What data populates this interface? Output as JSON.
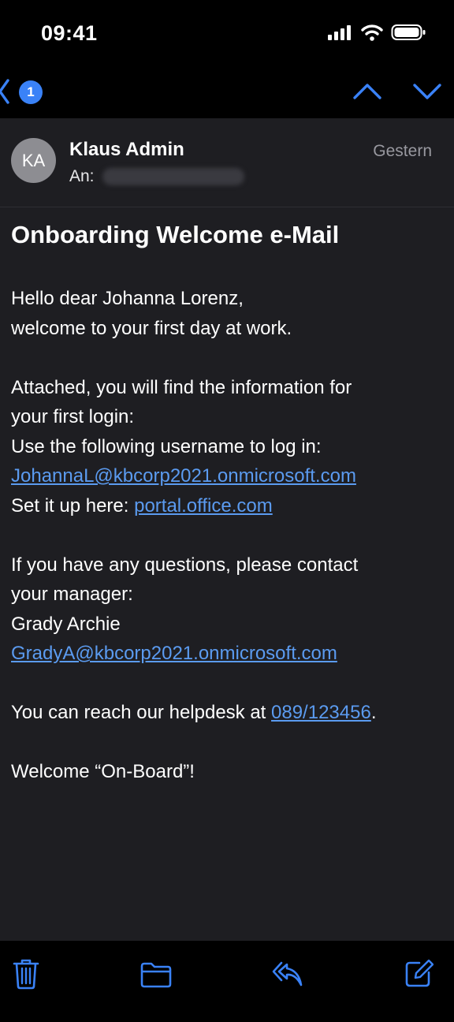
{
  "status_bar": {
    "time": "09:41"
  },
  "nav": {
    "unread_count": "1"
  },
  "message": {
    "avatar_initials": "KA",
    "sender": "Klaus Admin",
    "to_label": "An:",
    "date": "Gestern",
    "subject": "Onboarding Welcome e-Mail",
    "body": {
      "greeting_1": "Hello dear Johanna Lorenz,",
      "greeting_2": "welcome to your first day at work.",
      "attached_1": "Attached, you will find the information for",
      "attached_2": "your first login:",
      "username_intro": "Use the following username to log in:",
      "username_link": "JohannaL@kbcorp2021.onmicrosoft.com",
      "setup_label": "Set it up here: ",
      "setup_link": "portal.office.com",
      "questions_1": "If you have any questions, please contact",
      "questions_2": "your manager:",
      "manager_name": "Grady Archie",
      "manager_link": "GradyA@kbcorp2021.onmicrosoft.com",
      "helpdesk_label": "You can reach our helpdesk at ",
      "helpdesk_link": "089/123456",
      "helpdesk_end": ".",
      "closing": "Welcome “On-Board”!"
    }
  },
  "colors": {
    "accent": "#3a82f7",
    "link": "#5b9bf0",
    "background": "#1e1e22",
    "bars": "#000000"
  },
  "icons": [
    "signal-icon",
    "wifi-icon",
    "battery-icon",
    "back-chevron-icon",
    "previous-message-icon",
    "next-message-icon",
    "trash-icon",
    "folder-icon",
    "reply-icon",
    "compose-icon"
  ]
}
